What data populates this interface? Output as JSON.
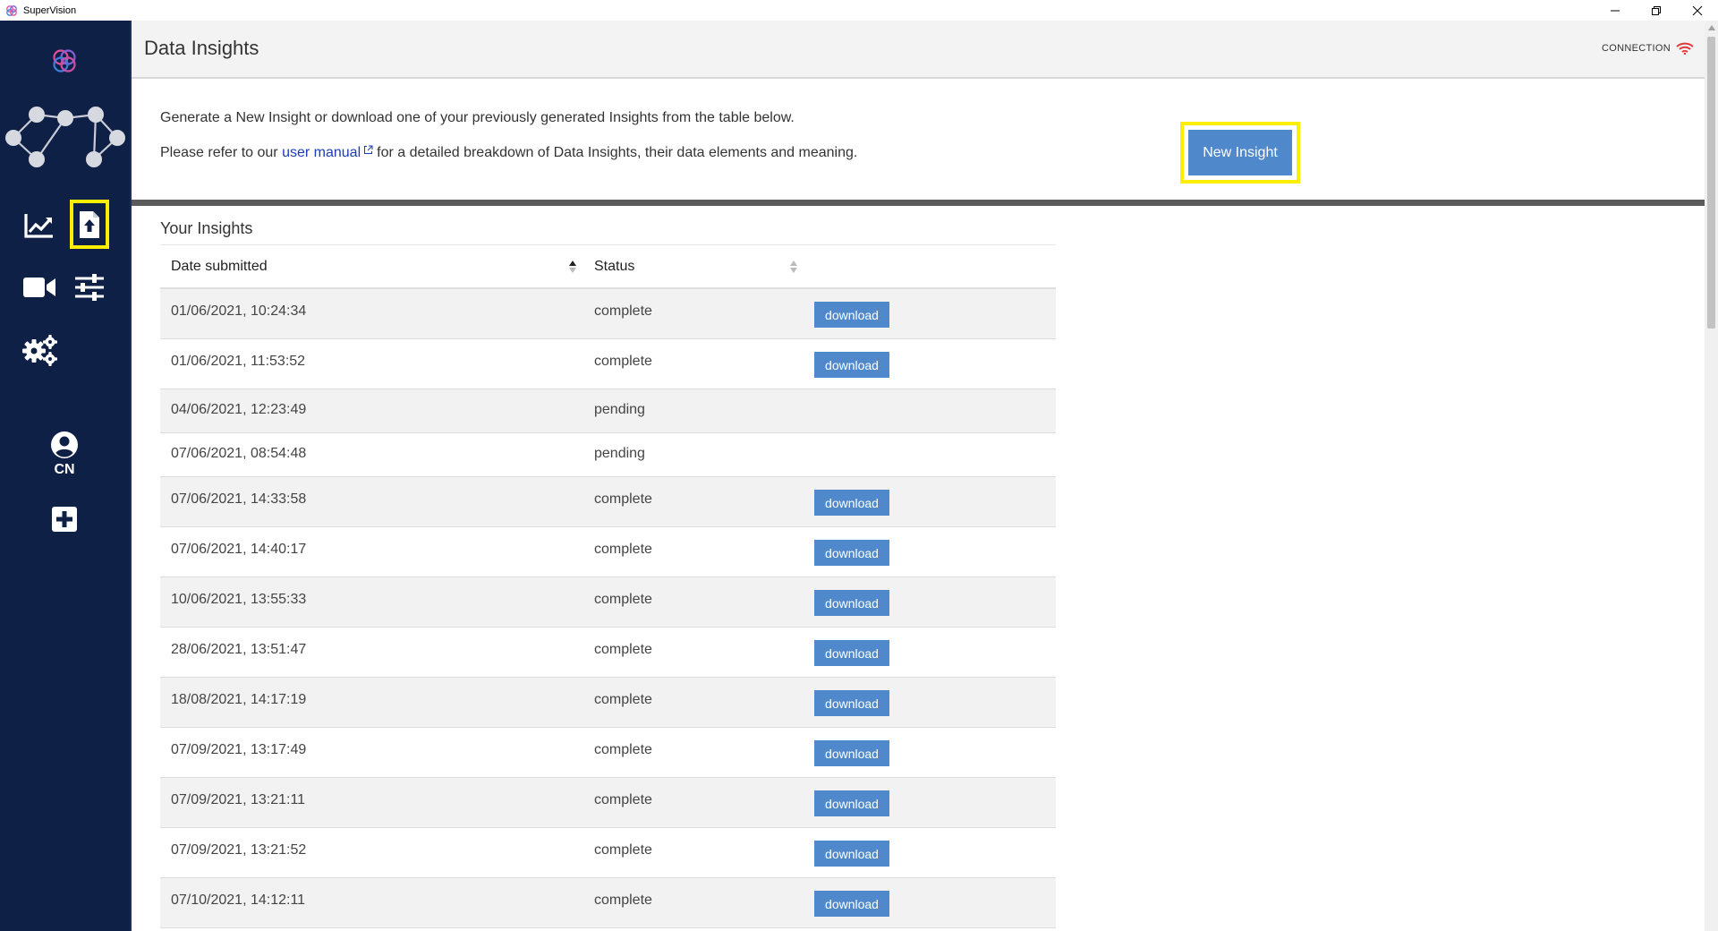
{
  "window": {
    "title": "SuperVision"
  },
  "sidebar": {
    "user_initials": "CN",
    "icons": [
      "app-logo-icon",
      "network-graph-icon",
      "chart-icon",
      "file-upload-icon",
      "video-camera-icon",
      "sliders-icon",
      "gears-icon",
      "user-icon",
      "plus-square-icon"
    ]
  },
  "header": {
    "title": "Data Insights",
    "connection_label": "CONNECTION"
  },
  "intro": {
    "line1": "Generate a New Insight or download one of your previously generated Insights from the table below.",
    "line2_before": "Please refer to our",
    "line2_link": "user manual",
    "line2_after": "for a detailed breakdown of Data Insights, their data elements and meaning.",
    "new_insight_label": "New Insight"
  },
  "insights": {
    "section_title": "Your Insights",
    "columns": {
      "date": "Date submitted",
      "status": "Status"
    },
    "download_label": "download",
    "rows": [
      {
        "date": "01/06/2021, 10:24:34",
        "status": "complete"
      },
      {
        "date": "01/06/2021, 11:53:52",
        "status": "complete"
      },
      {
        "date": "04/06/2021, 12:23:49",
        "status": "pending"
      },
      {
        "date": "07/06/2021, 08:54:48",
        "status": "pending"
      },
      {
        "date": "07/06/2021, 14:33:58",
        "status": "complete"
      },
      {
        "date": "07/06/2021, 14:40:17",
        "status": "complete"
      },
      {
        "date": "10/06/2021, 13:55:33",
        "status": "complete"
      },
      {
        "date": "28/06/2021, 13:51:47",
        "status": "complete"
      },
      {
        "date": "18/08/2021, 14:17:19",
        "status": "complete"
      },
      {
        "date": "07/09/2021, 13:17:49",
        "status": "complete"
      },
      {
        "date": "07/09/2021, 13:21:11",
        "status": "complete"
      },
      {
        "date": "07/09/2021, 13:21:52",
        "status": "complete"
      },
      {
        "date": "07/10/2021, 14:12:11",
        "status": "complete"
      }
    ]
  },
  "colors": {
    "sidebar_bg": "#0f2047",
    "accent_blue": "#4f89cc",
    "highlight": "#ffee00",
    "link": "#1a3db5",
    "connection_red": "#e03a3a"
  }
}
